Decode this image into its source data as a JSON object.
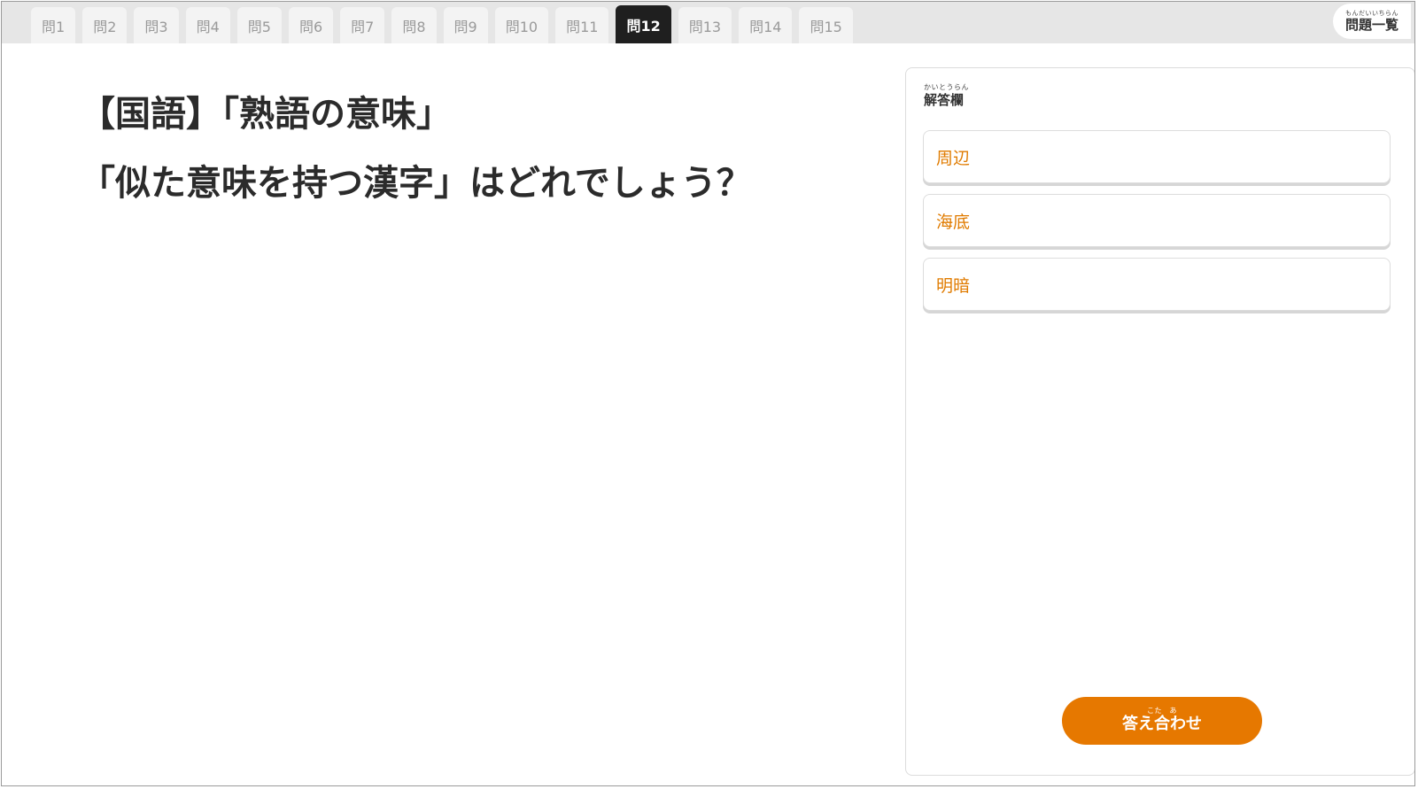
{
  "tabs": [
    {
      "label": "問1"
    },
    {
      "label": "問2"
    },
    {
      "label": "問3"
    },
    {
      "label": "問4"
    },
    {
      "label": "問5"
    },
    {
      "label": "問6"
    },
    {
      "label": "問7"
    },
    {
      "label": "問8"
    },
    {
      "label": "問9"
    },
    {
      "label": "問10"
    },
    {
      "label": "問11"
    },
    {
      "label": "問12"
    },
    {
      "label": "問13"
    },
    {
      "label": "問14"
    },
    {
      "label": "問15"
    }
  ],
  "active_tab": "問12",
  "problem_list": {
    "ruby": "もんだいいちらん",
    "label": "問題一覧"
  },
  "question": {
    "line1": "【国語】「熟語の意味」",
    "line2": "「似た意味を持つ漢字」はどれでしょう？"
  },
  "answer_panel": {
    "title_ruby": "かいとうらん",
    "title": "解答欄",
    "choices": [
      "周辺",
      "海底",
      "明暗"
    ]
  },
  "submit": {
    "ruby": "こた　あ",
    "label": "答え合わせ"
  },
  "colors": {
    "accent": "#e67800",
    "choice_text": "#e07b00",
    "active_tab": "#1f1f1f"
  }
}
